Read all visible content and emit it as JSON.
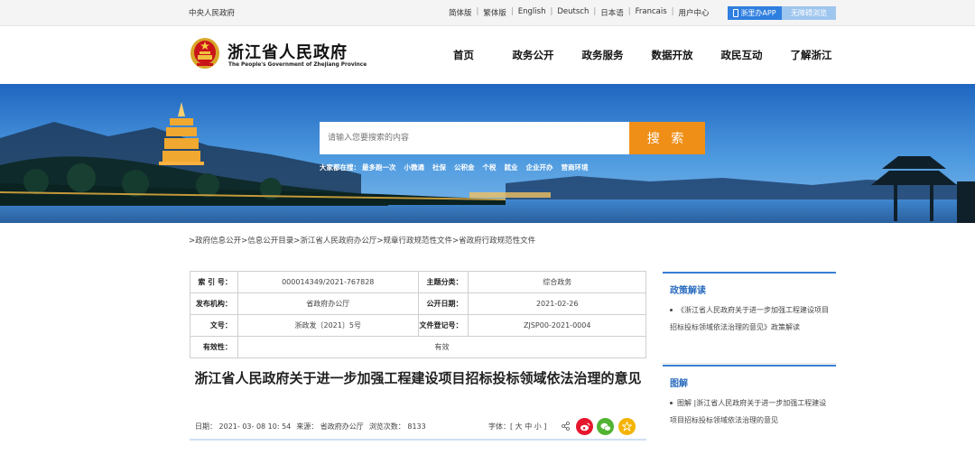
{
  "topbar": {
    "central": "中央人民政府",
    "languages": [
      "简体版",
      "繁体版",
      "English",
      "Deutsch",
      "日本语",
      "Francais",
      "用户中心"
    ],
    "app_btn": "浙里办APP",
    "access_btn": "无障碍浏览"
  },
  "header": {
    "title": "浙江省人民政府",
    "subtitle": "The People's Government of Zhejiang Province",
    "nav": [
      "首页",
      "政务公开",
      "政务服务",
      "数据开放",
      "政民互动",
      "了解浙江"
    ]
  },
  "search": {
    "placeholder": "请输入您要搜索的内容",
    "button": "搜 索",
    "hot_label": "大家都在搜：",
    "hot_items": [
      "最多跑一次",
      "小微通",
      "社保",
      "公积金",
      "个税",
      "就业",
      "企业开办",
      "营商环境"
    ]
  },
  "breadcrumb": [
    ">政府信息公开",
    ">信息公开目录",
    ">浙江省人民政府办公厅",
    ">规章行政规范性文件",
    ">省政府行政规范性文件"
  ],
  "info": {
    "index_label": "索 引 号：",
    "index_value": "000014349/2021-767828",
    "topic_label": "主题分类：",
    "topic_value": "综合政务",
    "issuer_label": "发布机构：",
    "issuer_value": "省政府办公厅",
    "pubdate_label": "公开日期：",
    "pubdate_value": "2021-02-26",
    "docno_label": "文号：",
    "docno_value": "浙政发〔2021〕5号",
    "regno_label": "文件登记号：",
    "regno_value": "ZJSP00-2021-0004",
    "valid_label": "有效性：",
    "valid_value": "有效"
  },
  "doc": {
    "title": "浙江省人民政府关于进一步加强工程建设项目招标投标领域依法治理的意见",
    "date": "日期： 2021- 03- 08 10: 54",
    "source": "来源： 省政府办公厅",
    "views": "浏览次数： 8133",
    "fontsize": "字体：[ 大 中 小 ]"
  },
  "sidebar": {
    "interpret_head": "政策解读",
    "interpret_item": "《浙江省人民政府关于进一步加强工程建设项目招标投标领域依法治理的意见》政策解读",
    "graphic_head": "图解",
    "graphic_item": "图解 |浙江省人民政府关于进一步加强工程建设项目招标投标领域依法治理的意见"
  },
  "colors": {
    "accent_blue": "#2f7fe0",
    "search_orange": "#ef8f17",
    "weibo_red": "#e6162d",
    "wechat_green": "#51b332",
    "fav_yellow": "#f3b300"
  }
}
